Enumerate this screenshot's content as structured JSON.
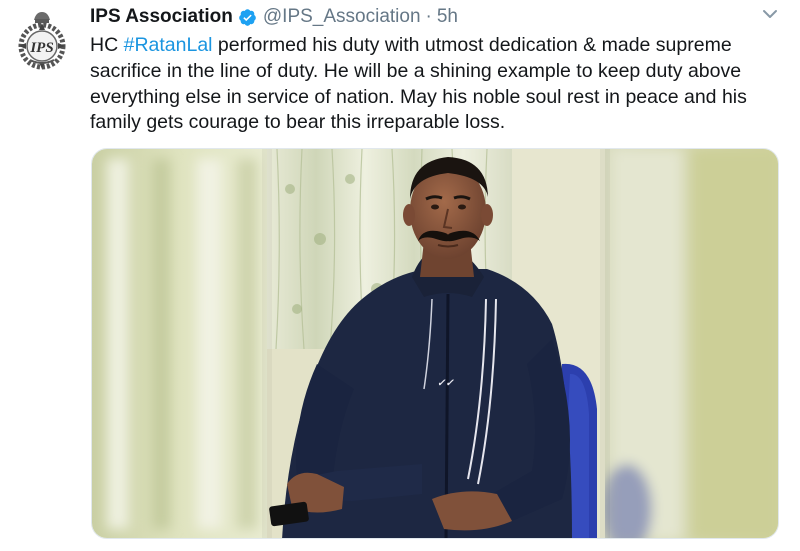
{
  "account": {
    "display_name": "IPS Association",
    "handle": "@IPS_Association",
    "separator": "·",
    "time": "5h",
    "verified": true,
    "avatar_icon": "police-emblem-logo",
    "logo_text": "IPS"
  },
  "tweet": {
    "lines": [
      {
        "prefix": "HC ",
        "hashtag": "#RatanLal",
        "suffix": " performed his duty with utmost dedication & made supreme"
      },
      {
        "text": "sacrifice in the line of duty. He will be a shining example to keep duty above"
      },
      {
        "text": "everything else in service of nation. May his noble soul rest in peace and his"
      },
      {
        "text": "family gets courage to bear this irreparable loss."
      }
    ]
  },
  "media": {
    "icon": "photo-of-man-in-navy-track-jacket"
  },
  "colors": {
    "link": "#1b95e0",
    "verified": "#1da1f2",
    "secondary_text": "#657786",
    "jacket": "#1d2742",
    "curtain": "#dfe3c8"
  },
  "icons": {
    "verified": "verified-badge-icon",
    "menu": "chevron-down-icon"
  }
}
